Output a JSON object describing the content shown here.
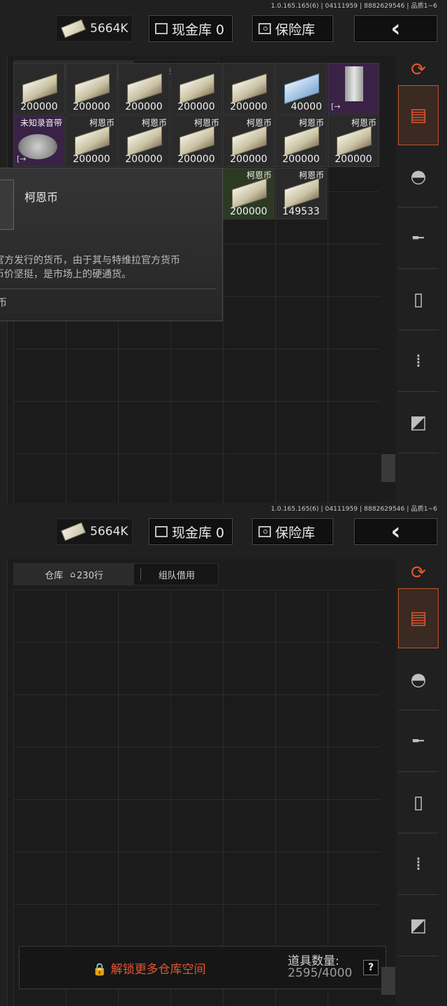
{
  "version": "1.0.165.165(6) | 04111959 | 8882629546 | 品质1~6",
  "topbar": {
    "money": "5664K",
    "cash_vault": "现金库 0",
    "safe": "保险库",
    "back": "‹"
  },
  "tabs": {
    "warehouse": "仓库",
    "house_icon": "⌂",
    "rows": "230行",
    "team_borrow": "组队借用"
  },
  "items_row1": [
    "200000",
    "200000",
    "200000",
    "200000",
    "200000",
    "40000"
  ],
  "items_row2": {
    "first_name": "未知录音带",
    "names": [
      "柯恩币",
      "柯恩币",
      "柯恩币",
      "柯恩币",
      "柯恩币",
      "柯恩币"
    ],
    "values": [
      "200000",
      "200000",
      "200000",
      "200000",
      "200000",
      "200000"
    ]
  },
  "items_row3": {
    "names": [
      "柯恩币",
      "柯恩币"
    ],
    "values": [
      "200000",
      "149533"
    ]
  },
  "tooltip": {
    "name": "柯恩币",
    "desc_line1": "官方发行的货币，由于其与特维拉官方货币",
    "desc_line2": "币价坚挺，是市场上的硬通货。",
    "category": "币"
  },
  "sidebar_icons": [
    "refresh-icon",
    "warehouse-icon",
    "helmet-icon",
    "rifle-icon",
    "magazine-icon",
    "ammo-icon",
    "accessory-icon"
  ],
  "unlock": {
    "label": "🔒 解锁更多仓库空间",
    "count_label": "道具数量:",
    "count_value": "2595/4000",
    "help": "?"
  },
  "colors": {
    "accent": "#e2562e"
  }
}
